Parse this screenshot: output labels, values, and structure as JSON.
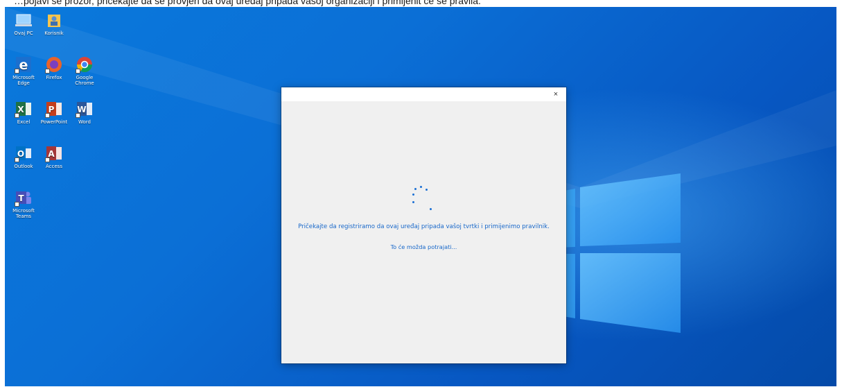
{
  "caption": "…pojavi se prozor, pričekajte da se provjeri da ovaj uređaj pripada vašoj organizaciji i primijenit će se pravila.",
  "desktop": {
    "icons": [
      {
        "label": "Ovaj PC",
        "icon": "this-pc-icon"
      },
      {
        "label": "Korisnik",
        "icon": "user-folder-icon"
      },
      {
        "label": "Microsoft Edge",
        "icon": "edge-icon"
      },
      {
        "label": "Firefox",
        "icon": "firefox-icon"
      },
      {
        "label": "Google Chrome",
        "icon": "chrome-icon"
      },
      {
        "label": "Excel",
        "icon": "excel-icon"
      },
      {
        "label": "PowerPoint",
        "icon": "powerpoint-icon"
      },
      {
        "label": "Word",
        "icon": "word-icon"
      },
      {
        "label": "Outlook",
        "icon": "outlook-icon"
      },
      {
        "label": "Access",
        "icon": "access-icon"
      },
      {
        "label": "Microsoft Teams",
        "icon": "teams-icon"
      }
    ]
  },
  "dialog": {
    "close_label": "×",
    "message": "Pričekajte da registriramo da ovaj uređaj pripada vašoj tvrtki i primijenimo pravilnik.",
    "sub_message": "To će možda potrajati..."
  },
  "colors": {
    "accent": "#1767c9",
    "desktop_blue": "#0b6fd6"
  }
}
